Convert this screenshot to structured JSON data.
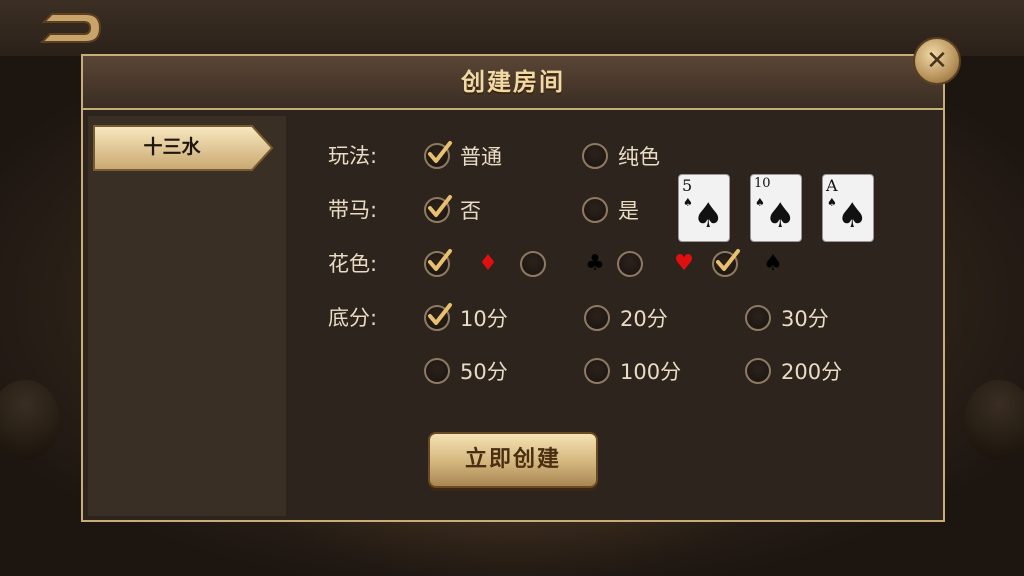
{
  "dialog": {
    "title": "创建房间"
  },
  "sidebar": {
    "items": [
      {
        "label": "十三水"
      }
    ]
  },
  "rows": {
    "play_label": "玩法:",
    "horse_label": "带马:",
    "suit_label": "花色:",
    "base_label": "底分:"
  },
  "play_options": [
    {
      "label": "普通",
      "checked": true
    },
    {
      "label": "纯色",
      "checked": false
    }
  ],
  "horse_options": [
    {
      "label": "否",
      "checked": true
    },
    {
      "label": "是",
      "checked": false
    }
  ],
  "horse_cards": [
    {
      "rank": "5"
    },
    {
      "rank": "10"
    },
    {
      "rank": "A"
    }
  ],
  "suit_options": [
    {
      "suit": "diamond-icon",
      "glyph": "♦",
      "color": "#e01010",
      "checked": true
    },
    {
      "suit": "club-icon",
      "glyph": "♣",
      "color": "#000000",
      "checked": false
    },
    {
      "suit": "heart-icon",
      "glyph": "♥",
      "color": "#e01010",
      "checked": false
    },
    {
      "suit": "spade-icon",
      "glyph": "♠",
      "color": "#000000",
      "checked": true
    }
  ],
  "base_options": [
    {
      "label": "10分",
      "checked": true
    },
    {
      "label": "20分",
      "checked": false
    },
    {
      "label": "30分",
      "checked": false
    },
    {
      "label": "50分",
      "checked": false
    },
    {
      "label": "100分",
      "checked": false
    },
    {
      "label": "200分",
      "checked": false
    }
  ],
  "create_button": {
    "label": "立即创建"
  },
  "colors": {
    "accent": "#c9ad78",
    "text": "#e9dcc4",
    "check": "#e8c070"
  }
}
